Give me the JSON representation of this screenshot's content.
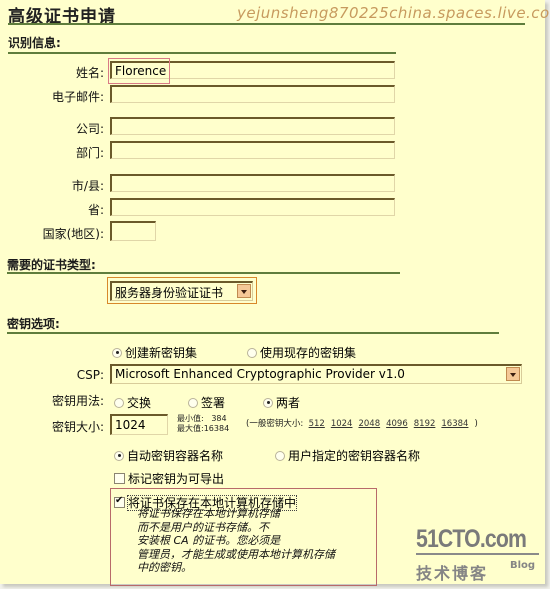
{
  "header": {
    "title": "高级证书申请",
    "watermark": "yejunsheng870225china.spaces.live.com"
  },
  "identification": {
    "section_title": "识别信息:",
    "fields": [
      {
        "label": "姓名:",
        "value": "Florence"
      },
      {
        "label": "电子邮件:",
        "value": ""
      },
      {
        "label": "公司:",
        "value": ""
      },
      {
        "label": "部门:",
        "value": ""
      },
      {
        "label": "市/县:",
        "value": ""
      },
      {
        "label": "省:",
        "value": ""
      },
      {
        "label": "国家(地区):",
        "value": ""
      }
    ]
  },
  "cert_type": {
    "section_title": "需要的证书类型:",
    "selected": "服务器身份验证证书"
  },
  "key_options": {
    "section_title": "密钥选项:",
    "keyset": {
      "options": [
        "创建新密钥集",
        "使用现存的密钥集"
      ],
      "selected": "创建新密钥集"
    },
    "csp": {
      "label": "CSP:",
      "selected": "Microsoft Enhanced Cryptographic Provider v1.0"
    },
    "key_usage": {
      "label": "密钥用法:",
      "options": [
        "交换",
        "签署",
        "两者"
      ],
      "selected": "两者"
    },
    "key_size": {
      "label": "密钥大小:",
      "value": "1024",
      "min_label": "最小值:",
      "min_value": "384",
      "max_label": "最大值:",
      "max_value": "16384",
      "common_prefix": "(一般密钥大小:",
      "common_sizes": [
        "512",
        "1024",
        "2048",
        "4096",
        "8192",
        "16384"
      ],
      "common_suffix": ")"
    },
    "container": {
      "options": [
        "自动密钥容器名称",
        "用户指定的密钥容器名称"
      ],
      "selected": "自动密钥容器名称"
    },
    "exportable": {
      "label": "标记密钥为可导出",
      "checked": false
    },
    "local_store": {
      "label": "将证书保存在本地计算机存储中",
      "checked": true,
      "description": [
        "将证书保存在本地计算机存储",
        "而不是用户的证书存储。不",
        "安装根 CA 的证书。您必须是",
        "管理员，才能生成或使用本地计算机存储",
        "中的密钥。"
      ]
    }
  },
  "brand": {
    "logo_main": "51CTO.com",
    "logo_sub": "技术博客",
    "logo_blog": "Blog"
  }
}
